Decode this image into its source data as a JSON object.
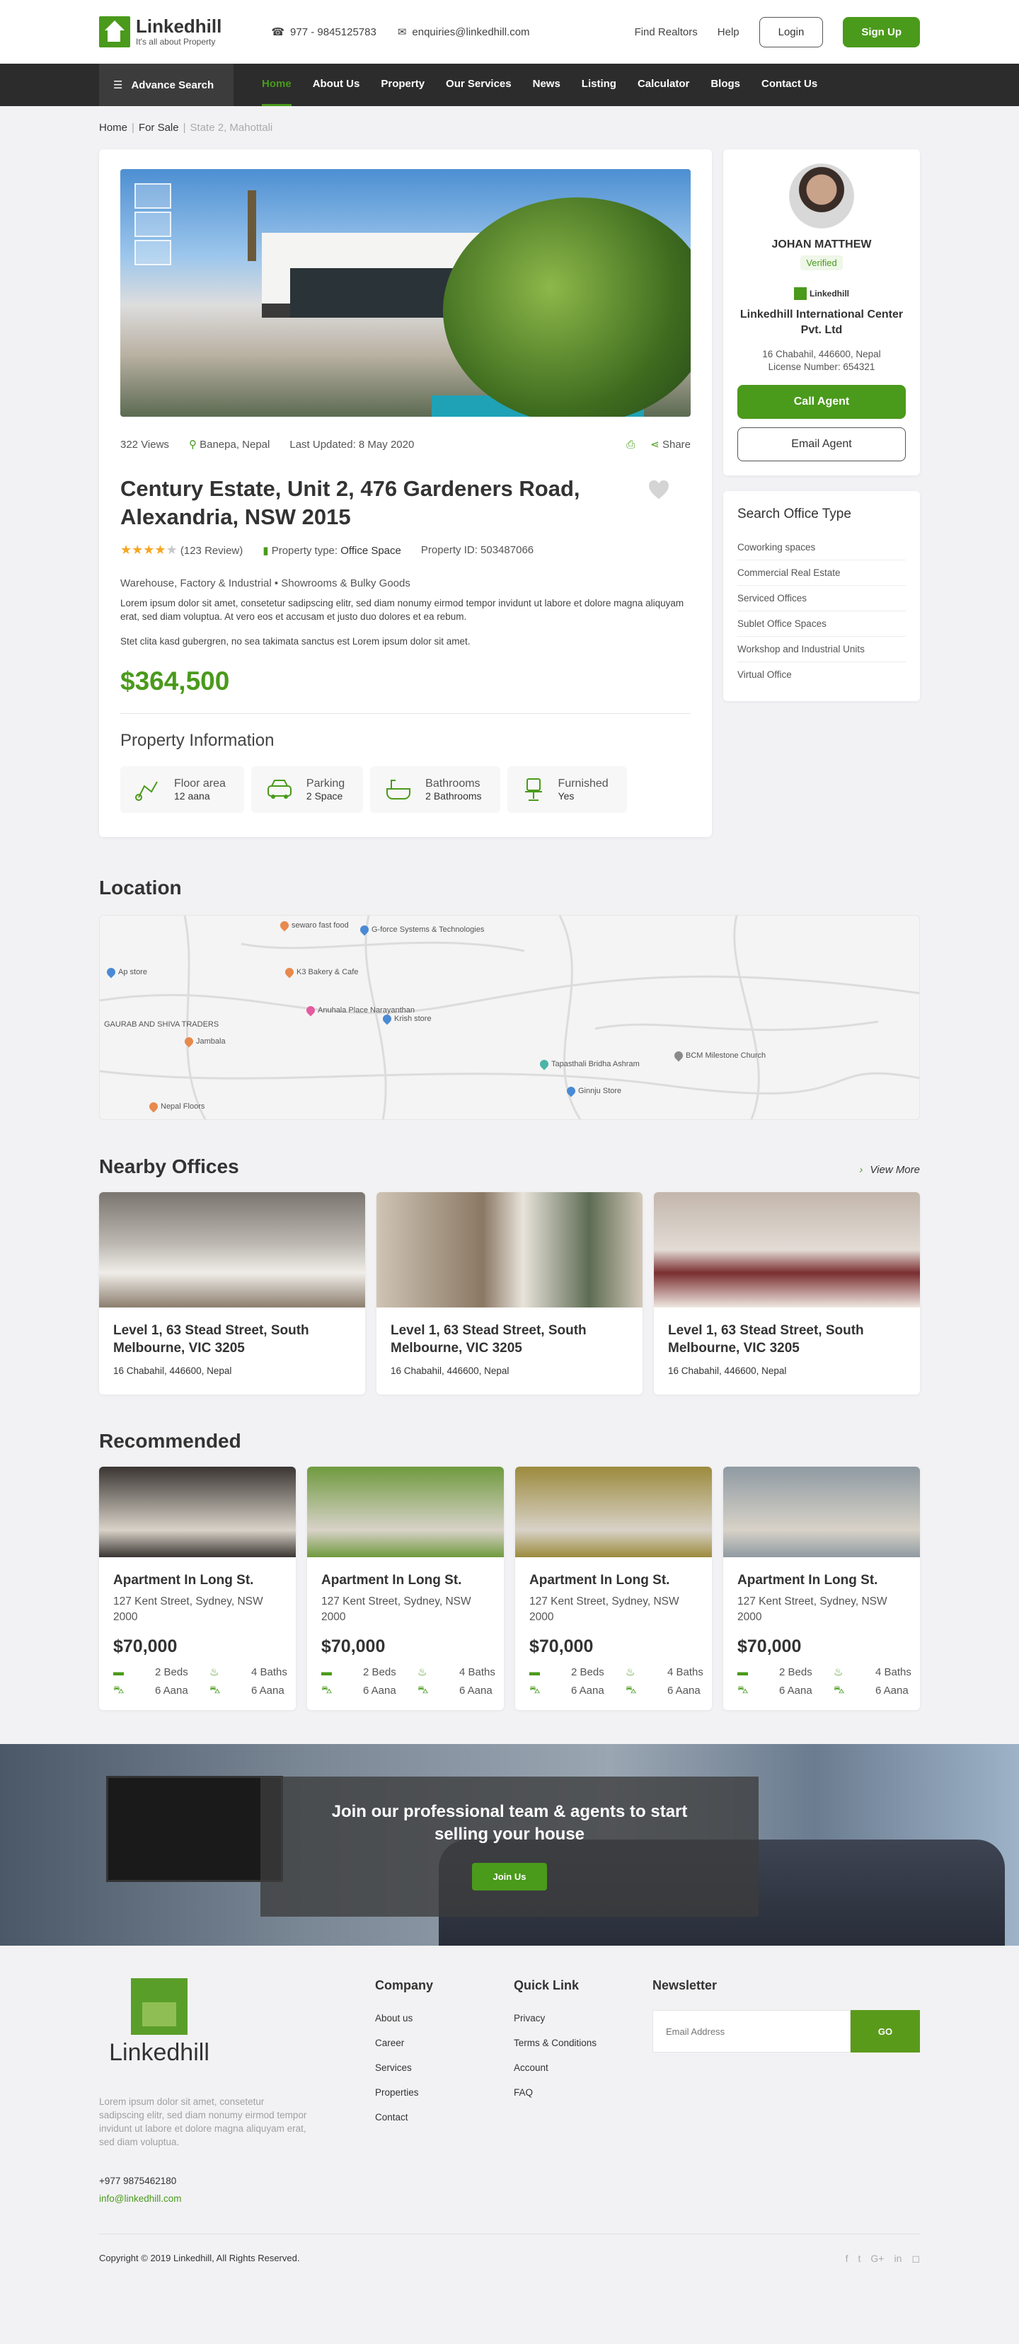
{
  "header": {
    "brand": "Linkedhill",
    "tagline": "It's all about Property",
    "phone": "977 - 9845125783",
    "email": "enquiries@linkedhill.com",
    "links": [
      "Find Realtors",
      "Help"
    ],
    "login": "Login",
    "signup": "Sign Up"
  },
  "nav": {
    "advance": "Advance Search",
    "items": [
      "Home",
      "About Us",
      "Property",
      "Our Services",
      "News",
      "Listing",
      "Calculator",
      "Blogs",
      "Contact Us"
    ]
  },
  "breadcrumb": [
    "Home",
    "For Sale",
    "State 2, Mahottali"
  ],
  "property": {
    "views": "322 Views",
    "location": "Banepa, Nepal",
    "updated": "Last Updated: 8 May 2020",
    "share": "Share",
    "title": "Century Estate, Unit 2, 476 Gardeners Road, Alexandria, NSW 2015",
    "rating": 4,
    "reviews": "(123 Review)",
    "type_label": "Property type:",
    "type_value": "Office Space",
    "id": "Property ID: 503487066",
    "category": "Warehouse, Factory & Industrial • Showrooms & Bulky Goods",
    "desc1": "Lorem ipsum dolor sit amet, consetetur sadipscing elitr, sed diam nonumy eirmod tempor invidunt ut labore et dolore magna aliquyam erat, sed diam voluptua. At vero eos et accusam et justo duo dolores et ea rebum.",
    "desc2": "Stet clita kasd gubergren, no sea takimata sanctus est Lorem ipsum dolor sit amet.",
    "price": "$364,500",
    "info_title": "Property Information",
    "features": [
      {
        "label": "Floor area",
        "value": "12 aana",
        "icon": "floor-area-icon"
      },
      {
        "label": "Parking",
        "value": "2 Space",
        "icon": "car-icon"
      },
      {
        "label": "Bathrooms",
        "value": "2 Bathrooms",
        "icon": "bathtub-icon"
      },
      {
        "label": "Furnished",
        "value": "Yes",
        "icon": "chair-icon"
      }
    ]
  },
  "agent": {
    "name": "JOHAN MATTHEW",
    "badge": "Verified",
    "logo": "Linkedhill",
    "org": "Linkedhill International Center Pvt. Ltd",
    "address": "16 Chabahil, 446600, Nepal",
    "license": "License Number: 654321",
    "call": "Call Agent",
    "email": "Email Agent"
  },
  "office_types": {
    "title": "Search Office Type",
    "items": [
      "Coworking spaces",
      "Commercial Real Estate",
      "Serviced Offices",
      "Sublet Office Spaces",
      "Workshop and Industrial Units",
      "Virtual Office"
    ]
  },
  "location": {
    "title": "Location",
    "places": [
      "sewaro fast food",
      "G-force Systems & Technologies",
      "K3 Bakery & Cafe",
      "Ap store",
      "Anuhala Place Narayanthan",
      "Krish store",
      "GAURAB AND SHIVA TRADERS",
      "Jambala",
      "Tapasthali Bridha Ashram",
      "BCM Milestone Church",
      "Ginnju Store",
      "Nepal Floors"
    ]
  },
  "nearby": {
    "title": "Nearby Offices",
    "viewmore": "View More",
    "items": [
      {
        "title": "Level 1, 63 Stead Street, South Melbourne, VIC 3205",
        "addr": "16 Chabahil, 446600, Nepal",
        "color": "#8a8580"
      },
      {
        "title": "Level 1, 63 Stead Street, South Melbourne, VIC 3205",
        "addr": "16 Chabahil, 446600, Nepal",
        "color": "#a89a86"
      },
      {
        "title": "Level 1, 63 Stead Street, South Melbourne, VIC 3205",
        "addr": "16 Chabahil, 446600, Nepal",
        "color": "#b9aba3"
      }
    ]
  },
  "recommended": {
    "title": "Recommended",
    "items": [
      {
        "title": "Apartment In Long St.",
        "addr": "127 Kent Street, Sydney, NSW 2000",
        "price": "$70,000",
        "beds": "2 Beds",
        "baths": "4 Baths",
        "a1": "6 Aana",
        "a2": "6 Aana",
        "color": "#3a3532"
      },
      {
        "title": "Apartment In Long St.",
        "addr": "127 Kent Street, Sydney, NSW 2000",
        "price": "$70,000",
        "beds": "2 Beds",
        "baths": "4 Baths",
        "a1": "6 Aana",
        "a2": "6 Aana",
        "color": "#6f9a3e"
      },
      {
        "title": "Apartment In Long St.",
        "addr": "127 Kent Street, Sydney, NSW 2000",
        "price": "$70,000",
        "beds": "2 Beds",
        "baths": "4 Baths",
        "a1": "6 Aana",
        "a2": "6 Aana",
        "color": "#9c8a3c"
      },
      {
        "title": "Apartment In Long St.",
        "addr": "127 Kent Street, Sydney, NSW 2000",
        "price": "$70,000",
        "beds": "2 Beds",
        "baths": "4 Baths",
        "a1": "6 Aana",
        "a2": "6 Aana",
        "color": "#8f9aa2"
      }
    ]
  },
  "banner": {
    "text": "Join our professional team & agents to start selling your house",
    "button": "Join Us"
  },
  "footer": {
    "brand": "Linkedhill",
    "about": "Lorem ipsum dolor sit amet, consetetur sadipscing elitr, sed diam nonumy eirmod tempor invidunt ut labore et dolore magna aliquyam erat, sed diam voluptua.",
    "phone": "+977 9875462180",
    "email": "info@linkedhill.com",
    "company": {
      "title": "Company",
      "items": [
        "About us",
        "Career",
        "Services",
        "Properties",
        "Contact"
      ]
    },
    "quick": {
      "title": "Quick Link",
      "items": [
        "Privacy",
        "Terms & Conditions",
        "Account",
        "FAQ"
      ]
    },
    "newsletter": {
      "title": "Newsletter",
      "placeholder": "Email Address",
      "button": "GO"
    },
    "copyright": "Copyright © 2019 Linkedhill, All Rights Reserved.",
    "social": [
      "facebook-icon",
      "twitter-icon",
      "google-plus-icon",
      "linkedin-icon",
      "instagram-icon"
    ]
  }
}
